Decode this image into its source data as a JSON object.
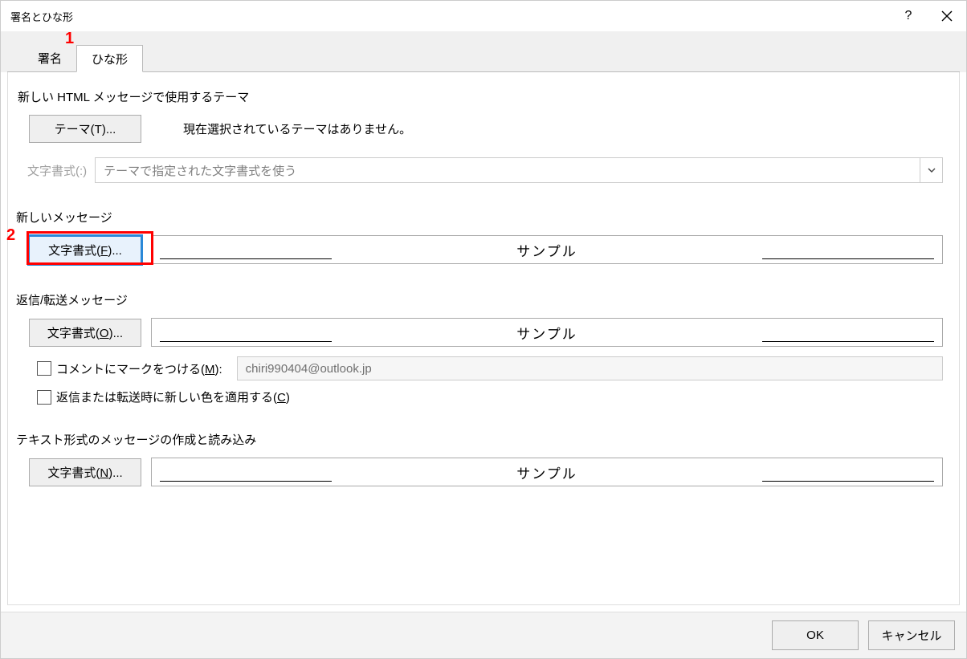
{
  "dialog": {
    "title": "署名とひな形"
  },
  "tabs": {
    "signature": "署名",
    "stationery": "ひな形"
  },
  "sections": {
    "html_theme_label": "新しい HTML メッセージで使用するテーマ",
    "theme_button": "テーマ(T)...",
    "theme_status": "現在選択されているテーマはありません。",
    "font_style_label": "文字書式(:)",
    "font_style_dropdown": "テーマで指定された文字書式を使う",
    "new_message_label": "新しいメッセージ",
    "font_button_f": "文字書式(F)...",
    "reply_forward_label": "返信/転送メッセージ",
    "font_button_o": "文字書式(O)...",
    "mark_comments_prefix": "コメントにマークをつける(",
    "mark_comments_key": "M",
    "mark_comments_suffix": "):",
    "email_value": "chiri990404@outlook.jp",
    "new_color_prefix": "返信または転送時に新しい色を適用する(",
    "new_color_key": "C",
    "new_color_suffix": ")",
    "plaintext_label": "テキスト形式のメッセージの作成と読み込み",
    "font_button_n": "文字書式(N)...",
    "sample_text": "サンプル"
  },
  "footer": {
    "ok": "OK",
    "cancel": "キャンセル"
  },
  "annotations": {
    "num1": "1",
    "num2": "2"
  }
}
